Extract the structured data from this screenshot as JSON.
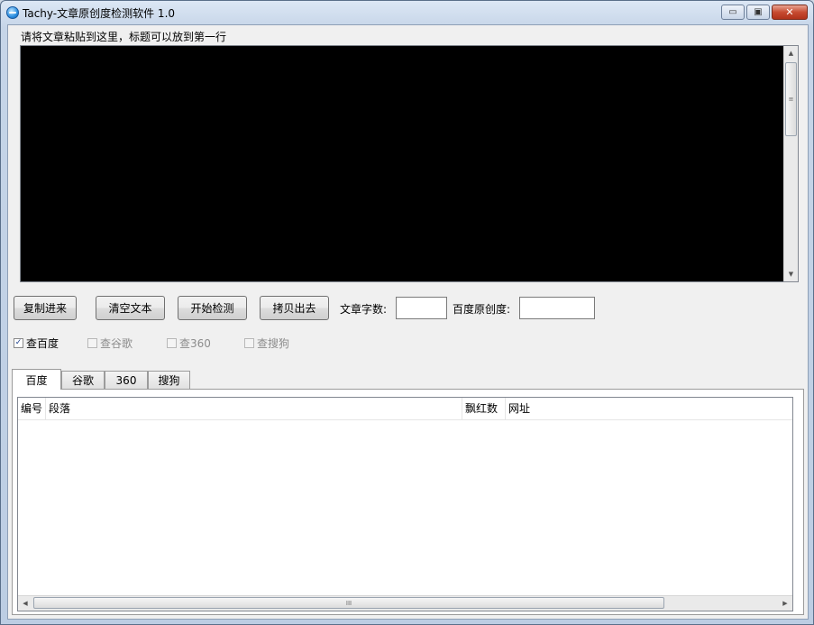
{
  "window": {
    "title": "Tachy-文章原创度检测软件 1.0",
    "minimize": "▭",
    "maximize": "▣",
    "close": "✕"
  },
  "input_section": {
    "label": "请将文章粘贴到这里，标题可以放到第一行"
  },
  "toolbar": {
    "copy_in": "复制进来",
    "clear_text": "清空文本",
    "start_check": "开始检测",
    "copy_out": "拷贝出去",
    "word_count_label": "文章字数:",
    "word_count_value": "",
    "baidu_originality_label": "百度原创度:",
    "baidu_originality_value": ""
  },
  "options": [
    {
      "label": "查百度",
      "checked": true,
      "enabled": true
    },
    {
      "label": "查谷歌",
      "checked": false,
      "enabled": false
    },
    {
      "label": "查360",
      "checked": false,
      "enabled": false
    },
    {
      "label": "查搜狗",
      "checked": false,
      "enabled": false
    }
  ],
  "tabs": [
    {
      "label": "百度",
      "active": true
    },
    {
      "label": "谷歌",
      "active": false
    },
    {
      "label": "360",
      "active": false
    },
    {
      "label": "搜狗",
      "active": false
    }
  ],
  "results_table": {
    "columns": [
      "编号",
      "段落",
      "飘红数",
      "网址"
    ],
    "rows": []
  },
  "scroll_glyphs": {
    "up": "▲",
    "down": "▼",
    "left": "◀",
    "right": "▶",
    "grip_v": "≡",
    "grip_h": "III"
  }
}
